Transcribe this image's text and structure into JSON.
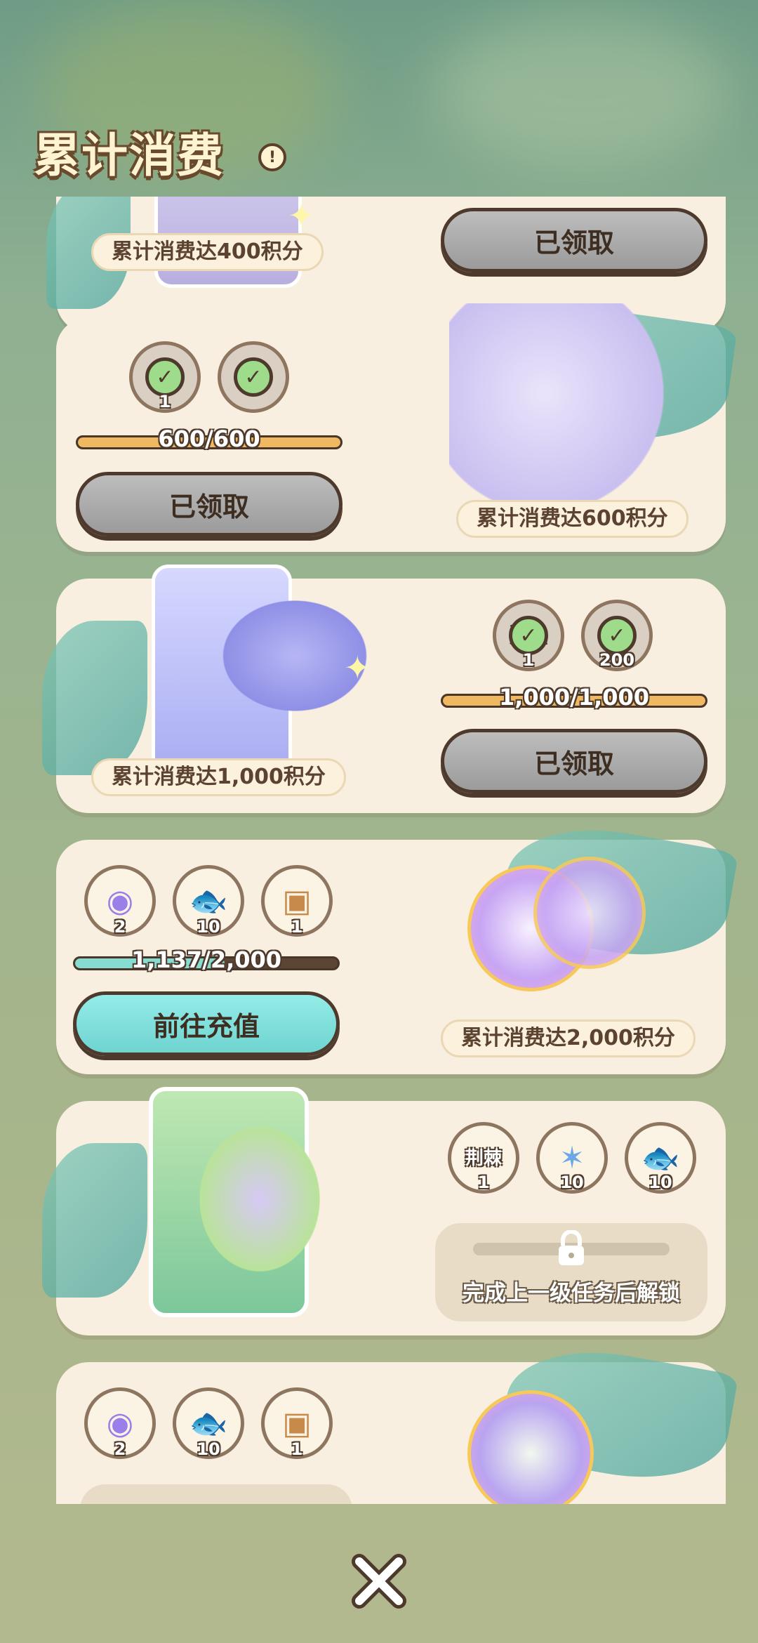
{
  "header": {
    "title": "累计消费",
    "info_icon": "info-icon"
  },
  "tiers": [
    {
      "label": "累计消费达400积分",
      "button": "已领取",
      "state": "claimed"
    },
    {
      "label": "累计消费达600积分",
      "progress_text": "600/600",
      "progress": 1.0,
      "button": "已领取",
      "state": "claimed",
      "rewards": [
        {
          "qty": "1",
          "claimed": true
        },
        {
          "qty": "",
          "claimed": true
        }
      ]
    },
    {
      "label": "累计消费达1,000积分",
      "progress_text": "1,000/1,000",
      "progress": 1.0,
      "button": "已领取",
      "state": "claimed",
      "rewards": [
        {
          "name": "流星",
          "qty": "1",
          "claimed": true
        },
        {
          "qty": "200",
          "claimed": true
        }
      ]
    },
    {
      "label": "累计消费达2,000积分",
      "progress_text": "1,137/2,000",
      "progress": 0.5685,
      "button": "前往充值",
      "state": "active",
      "rewards": [
        {
          "icon": "bunny-orb-icon",
          "qty": "2"
        },
        {
          "icon": "taiyaki-icon",
          "qty": "10"
        },
        {
          "icon": "box-plus-icon",
          "qty": "1"
        }
      ]
    },
    {
      "label": "",
      "state": "locked",
      "locked_text": "完成上一级任务后解锁",
      "rewards": [
        {
          "name": "荆棘",
          "qty": "1"
        },
        {
          "icon": "crystal-icon",
          "qty": "10"
        },
        {
          "icon": "taiyaki-icon",
          "qty": "10"
        }
      ]
    },
    {
      "label": "",
      "state": "locked",
      "rewards": [
        {
          "icon": "fairy-orb-icon",
          "qty": "2"
        },
        {
          "icon": "taiyaki-icon",
          "qty": "10"
        },
        {
          "icon": "box-plus-icon",
          "qty": "1"
        }
      ]
    }
  ],
  "close": {
    "icon": "close-icon"
  },
  "colors": {
    "claimed_button": "#9b9b9b",
    "go_button": "#6fd4d0",
    "progress_full": "#f0b860",
    "progress_active": "#86dcd0",
    "card": "#f8efe0"
  }
}
